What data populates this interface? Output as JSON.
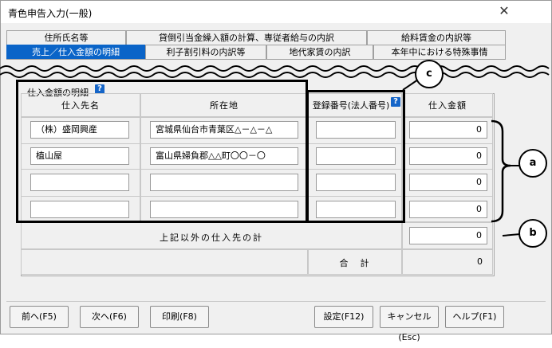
{
  "window": {
    "title": "青色申告入力(一般)",
    "close_glyph": "✕"
  },
  "tabs_row1": [
    "住所氏名等",
    "貸倒引当金繰入額の計算、専従者給与の内訳",
    "給料賃金の内訳等"
  ],
  "tabs_row2": [
    "売上／仕入金額の明細",
    "利子割引料の内訳等",
    "地代家賃の内訳",
    "本年中における特殊事情"
  ],
  "group": {
    "label": "仕入金額の明細",
    "help": "?"
  },
  "columns": {
    "name": "仕入先名",
    "address": "所在地",
    "regno": "登録番号(法人番号)",
    "amount": "仕入金額"
  },
  "rows": [
    {
      "name": "（株）盛岡興産",
      "address": "宮城県仙台市青葉区△－△－△",
      "regno": "",
      "amount": "0"
    },
    {
      "name": "植山屋",
      "address": "富山県婦負郡△△町〇〇－〇",
      "regno": "",
      "amount": "0"
    },
    {
      "name": "",
      "address": "",
      "regno": "",
      "amount": "0"
    },
    {
      "name": "",
      "address": "",
      "regno": "",
      "amount": "0"
    }
  ],
  "other_total": {
    "label": "上記以外の仕入先の計",
    "value": "0"
  },
  "grand_total": {
    "label": "合　計",
    "value": "0"
  },
  "callouts": {
    "a": "a",
    "b": "b",
    "c": "c"
  },
  "buttons": {
    "prev": "前へ(F5)",
    "next": "次へ(F6)",
    "print": "印刷(F8)",
    "settings": "設定(F12)",
    "cancel": "キャンセル(Esc)",
    "help": "ヘルプ(F1)"
  }
}
